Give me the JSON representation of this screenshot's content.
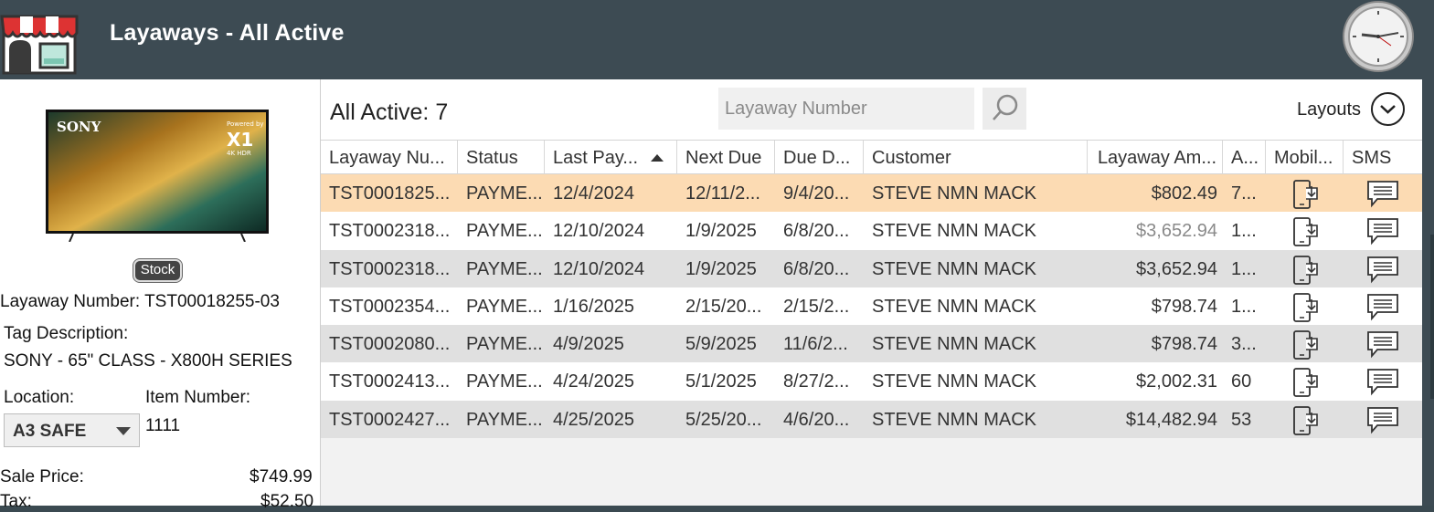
{
  "header": {
    "title": "Layaways - All Active",
    "store_icon": "store-icon",
    "clock_icon": "clock-icon"
  },
  "detail": {
    "product_image": "tv-image",
    "stock_label": "Stock",
    "layaway_number_label": "Layaway Number:",
    "layaway_number_value": "TST00018255-03",
    "tag_description_label": "Tag Description:",
    "tag_description_value": "SONY - 65\" CLASS - X800H SERIES",
    "location_label": "Location:",
    "location_value": "A3 SAFE",
    "item_number_label": "Item Number:",
    "item_number_value": "1111",
    "sale_price_label": "Sale Price:",
    "sale_price_value": "$749.99",
    "tax_label": "Tax:",
    "tax_value": "$52.50"
  },
  "toolbar": {
    "count_label": "All Active: 7",
    "search_placeholder": "Layaway Number",
    "layouts_label": "Layouts"
  },
  "grid": {
    "columns": [
      "Layaway Nu...",
      "Status",
      "Last Pay...",
      "Next Due",
      "Due D...",
      "Customer",
      "Layaway Am...",
      "A...",
      "Mobil...",
      "SMS"
    ],
    "sorted_column": "Last Pay...",
    "sort_direction": "ascending",
    "rows": [
      {
        "number": "TST0001825...",
        "status": "PAYME...",
        "last_pay": "12/4/2024",
        "next_due": "12/11/2...",
        "due_date": "9/4/20...",
        "customer": "STEVE NMN MACK",
        "amount": "$802.49",
        "a": "7...",
        "selected": true
      },
      {
        "number": "TST0002318...",
        "status": "PAYME...",
        "last_pay": "12/10/2024",
        "next_due": "1/9/2025",
        "due_date": "6/8/20...",
        "customer": "STEVE NMN MACK",
        "amount": "$3,652.94",
        "a": "1...",
        "selected": false
      },
      {
        "number": "TST0002318...",
        "status": "PAYME...",
        "last_pay": "12/10/2024",
        "next_due": "1/9/2025",
        "due_date": "6/8/20...",
        "customer": "STEVE NMN MACK",
        "amount": "$3,652.94",
        "a": "1...",
        "selected": false
      },
      {
        "number": "TST0002354...",
        "status": "PAYME...",
        "last_pay": "1/16/2025",
        "next_due": "2/15/20...",
        "due_date": "2/15/2...",
        "customer": "STEVE NMN MACK",
        "amount": "$798.74",
        "a": "1...",
        "selected": false
      },
      {
        "number": "TST0002080...",
        "status": "PAYME...",
        "last_pay": "4/9/2025",
        "next_due": "5/9/2025",
        "due_date": "11/6/2...",
        "customer": "STEVE NMN MACK",
        "amount": "$798.74",
        "a": "3...",
        "selected": false
      },
      {
        "number": "TST0002413...",
        "status": "PAYME...",
        "last_pay": "4/24/2025",
        "next_due": "5/1/2025",
        "due_date": "8/27/2...",
        "customer": "STEVE NMN MACK",
        "amount": "$2,002.31",
        "a": "60",
        "selected": false
      },
      {
        "number": "TST0002427...",
        "status": "PAYME...",
        "last_pay": "4/25/2025",
        "next_due": "5/25/20...",
        "due_date": "4/6/20...",
        "customer": "STEVE NMN MACK",
        "amount": "$14,482.94",
        "a": "53",
        "selected": false
      }
    ],
    "mobile_icon": "mobile-download-icon",
    "sms_icon": "sms-icon"
  },
  "colors": {
    "header_bg": "#3d4b53",
    "selected_row": "#fcdbb3",
    "alt_row": "#e0e0e0"
  }
}
